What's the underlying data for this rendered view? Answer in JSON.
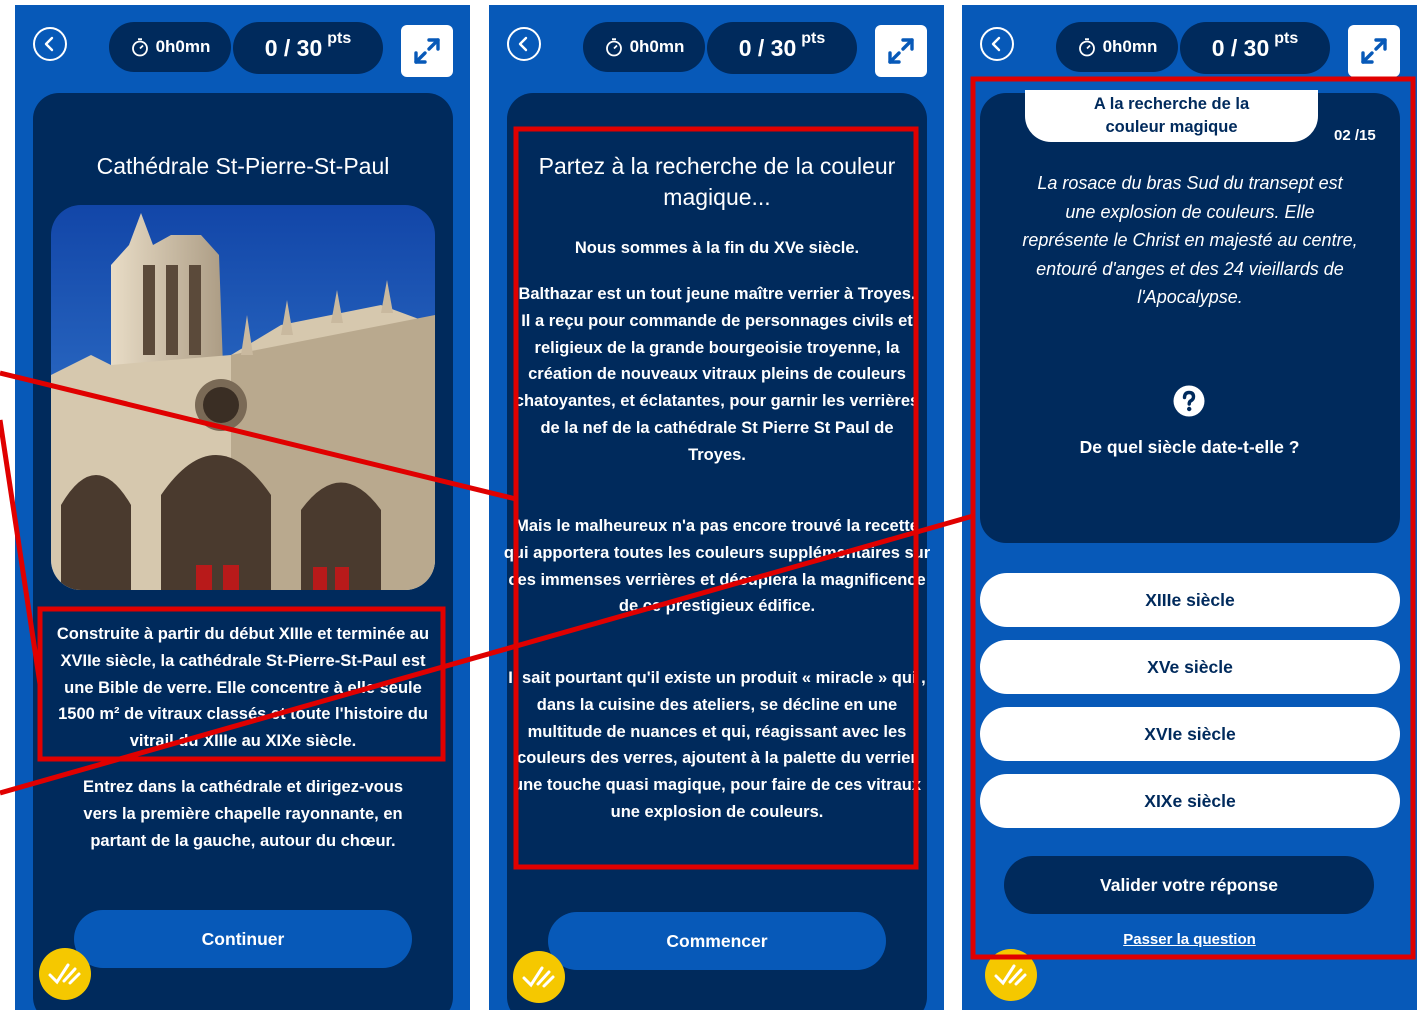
{
  "topbar": {
    "timer": "0h0mn",
    "score": "0 / 30",
    "score_unit": "pts"
  },
  "screen1": {
    "title": "Cathédrale St-Pierre-St-Paul",
    "image_alt": "",
    "intro": "Construite à partir du début XIIIe et terminée au XVIIe siècle, la cathédrale St-Pierre-St-Paul est une Bible de verre. Elle concentre à elle seule 1500 m² de vitraux classés et toute l'histoire du vitrail du XIIIe au XIXe siècle.",
    "directions": "Entrez dans la cathédrale et dirigez-vous vers la première chapelle rayonnante, en partant de la gauche, autour du chœur.",
    "button": "Continuer"
  },
  "screen2": {
    "title": "Partez à la recherche de la couleur magique...",
    "p1": "Nous sommes à la fin du XVe siècle.",
    "p2": "Balthazar est un tout jeune maître verrier à Troyes. Il a reçu pour commande de personnages civils et religieux de la grande bourgeoisie troyenne, la création de nouveaux vitraux pleins de couleurs chatoyantes, et éclatantes, pour garnir les verrières de la nef de la cathédrale St Pierre St Paul de Troyes.",
    "p3": "Mais le malheureux n'a pas encore trouvé la recette qui apportera toutes les couleurs supplémentaires sur ces immenses verrières et décuplera la magnificence de ce prestigieux édifice.",
    "p4": "Il sait pourtant qu'il existe un produit « miracle » qui , dans la cuisine des ateliers, se décline en une multitude de nuances et qui, réagissant avec les couleurs des verres, ajoutent à la palette du verrier une touche quasi magique, pour faire de ces vitraux une explosion de couleurs.",
    "button": "Commencer"
  },
  "screen3": {
    "tab": "A la recherche de la couleur magique",
    "counter": "02 /15",
    "question": "La rosace du bras Sud du transept est une explosion de couleurs. Elle représente le Christ en majesté au centre, entouré d'anges et des 24 vieillards de l'Apocalypse.",
    "prompt": "De quel siècle date-t-elle ?",
    "options": [
      "XIIIe siècle",
      "XVe siècle",
      "XVIe siècle",
      "XIXe siècle"
    ],
    "validate": "Valider votre réponse",
    "skip": "Passer la question"
  },
  "colors": {
    "background": "#0759b8",
    "card": "#002a5c",
    "annotation": "#e00000",
    "badge": "#f5c800"
  },
  "icons": {
    "back": "back-arrow-circle-icon",
    "timer": "stopwatch-icon",
    "expand": "expand-arrows-icon",
    "help": "question-circle-icon",
    "badge": "check-badge-icon"
  }
}
